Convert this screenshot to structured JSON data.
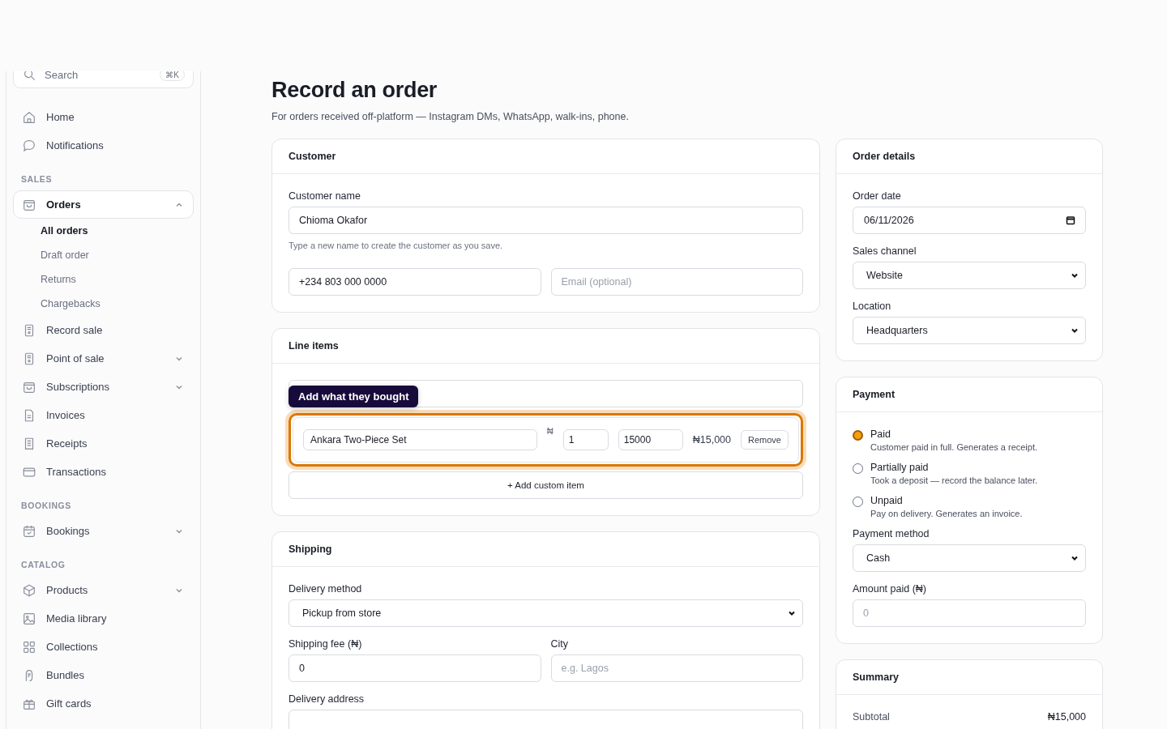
{
  "sidebar": {
    "search": {
      "placeholder": "Search",
      "shortcut": "⌘K"
    },
    "top_items": [
      {
        "label": "Home",
        "selected": false
      },
      {
        "label": "Notifications",
        "selected": false
      }
    ],
    "sections": [
      {
        "title": "SALES",
        "items": [
          {
            "label": "Orders",
            "selected": true,
            "expanded": true,
            "children": [
              {
                "label": "All orders",
                "selected": true
              },
              {
                "label": "Draft order",
                "selected": false
              },
              {
                "label": "Returns",
                "selected": false
              },
              {
                "label": "Chargebacks",
                "selected": false
              }
            ]
          },
          {
            "label": "Record sale",
            "selected": false
          },
          {
            "label": "Point of sale",
            "selected": false,
            "expanded": false
          },
          {
            "label": "Subscriptions",
            "selected": false,
            "expanded": false
          },
          {
            "label": "Invoices",
            "selected": false
          },
          {
            "label": "Receipts",
            "selected": false
          },
          {
            "label": "Transactions",
            "selected": false
          }
        ]
      },
      {
        "title": "BOOKINGS",
        "items": [
          {
            "label": "Bookings",
            "selected": false,
            "expanded": false
          }
        ]
      },
      {
        "title": "CATALOG",
        "items": [
          {
            "label": "Products",
            "selected": false,
            "expanded": false
          },
          {
            "label": "Media library",
            "selected": false
          },
          {
            "label": "Collections",
            "selected": false
          },
          {
            "label": "Bundles",
            "selected": false
          },
          {
            "label": "Gift cards",
            "selected": false
          }
        ]
      }
    ]
  },
  "page": {
    "title": "Record an order",
    "subtitle": "For orders received off-platform — Instagram DMs, WhatsApp, walk-ins, phone."
  },
  "customer": {
    "title": "Customer",
    "name_label": "Customer name",
    "name_value": "Chioma Okafor",
    "hint": "Type a new name to create the customer as you save.",
    "phone_value": "+234 803 000 0000",
    "email_placeholder": "Email (optional)"
  },
  "line_items": {
    "title": "Line items",
    "tooltip": "Add what they bought",
    "items": [
      {
        "name": "Ankara Two-Piece Set",
        "currency": "₦",
        "quantity": "1",
        "price": "15000",
        "total": "₦15,000",
        "remove": "Remove",
        "highlighted": true
      }
    ],
    "add_button": "+ Add custom item"
  },
  "shipping": {
    "title": "Shipping",
    "method_label": "Delivery method",
    "method_value": "Pickup from store",
    "fee_label": "Shipping fee (₦)",
    "fee_value": "0",
    "city_label": "City",
    "city_placeholder": "e.g. Lagos",
    "address_label": "Delivery address"
  },
  "order_details": {
    "title": "Order details",
    "date_label": "Order date",
    "date_value": "06/11/2026",
    "channel_label": "Sales channel",
    "channel_value": "Website",
    "location_label": "Location",
    "location_value": "Headquarters"
  },
  "payment": {
    "title": "Payment",
    "statuses": [
      {
        "label": "Paid",
        "description": "Customer paid in full. Generates a receipt.",
        "selected": true
      },
      {
        "label": "Partially paid",
        "description": "Took a deposit — record the balance later.",
        "selected": false
      },
      {
        "label": "Unpaid",
        "description": "Pay on delivery. Generates an invoice.",
        "selected": false
      }
    ],
    "method_label": "Payment method",
    "method_value": "Cash",
    "amount_label": "Amount paid (₦)",
    "amount_placeholder": "0"
  },
  "summary": {
    "title": "Summary",
    "rows": [
      {
        "label": "Subtotal",
        "value": "₦15,000"
      }
    ]
  }
}
